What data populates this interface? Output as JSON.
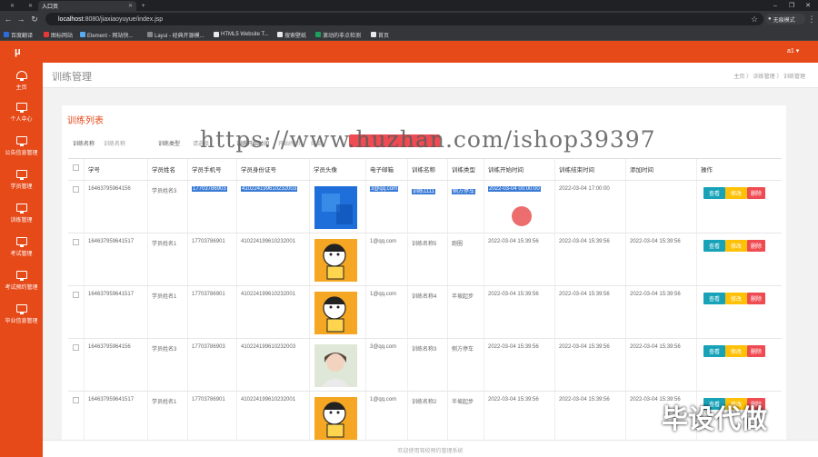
{
  "browser": {
    "tabs": [
      {
        "label": ""
      },
      {
        "label": ""
      },
      {
        "label": "入口页"
      }
    ],
    "url_host": "localhost",
    "url_rest": ":8080/jiaxiaoyuyue/index.jsp",
    "profile": "无痕模式",
    "bookmarks": [
      "百度翻译",
      "图标网站",
      "Element - 网站快...",
      "Layui - 经典开源模...",
      "HTML5 Website T...",
      "搜索壁纸",
      "滚动的非点检测",
      "首页"
    ]
  },
  "app": {
    "logo": "μ",
    "user": "a1 ▾",
    "sidebar": [
      {
        "label": "主页"
      },
      {
        "label": "个人中心"
      },
      {
        "label": "公告信息管理"
      },
      {
        "label": "学员管理"
      },
      {
        "label": "训练管理"
      },
      {
        "label": "考试管理"
      },
      {
        "label": "考试预约管理"
      },
      {
        "label": "毕业信息管理"
      }
    ],
    "page_title": "训练管理",
    "breadcrumb": "主页 〉 训练管理 〉 训练管理",
    "card_title": "训练列表",
    "filters": [
      "训练名称",
      "训练名称",
      "训练类型",
      "请选择",
      "训练开始时间",
      "开始时间",
      "结束"
    ],
    "footer": "欢迎使用驾校预约管理系统"
  },
  "table": {
    "headers": [
      "学号",
      "学员姓名",
      "学员手机号",
      "学员身份证号",
      "学员头像",
      "电子邮箱",
      "训练名称",
      "训练类型",
      "训练开始时间",
      "训练结束时间",
      "添加时间",
      "操作"
    ],
    "rows": [
      {
        "id": "1646379596415​6",
        "name": "学员姓名3",
        "phone": "17703786903",
        "idcard": "410224199610232003",
        "email": "3@qq.com",
        "train": "训练1111",
        "type": "侧方停车",
        "start": "2022-03-04 00:00:00",
        "end": "2022-03-04 17:00:00",
        "added": "",
        "avatar": "blue"
      },
      {
        "id": "16463795964151​7",
        "name": "学员姓名1",
        "phone": "17703786901",
        "idcard": "410224199610232001",
        "email": "1@qq.com",
        "train": "训练名称5",
        "type": "跑圈",
        "start": "2022-03-04 15:39:56",
        "end": "2022-03-04 15:39:56",
        "added": "2022-03-04 15:39:56",
        "avatar": "cartoon"
      },
      {
        "id": "16463795964151​7",
        "name": "学员姓名1",
        "phone": "17703786901",
        "idcard": "410224199610232001",
        "email": "1@qq.com",
        "train": "训练名称4",
        "type": "半坡起步",
        "start": "2022-03-04 15:39:56",
        "end": "2022-03-04 15:39:56",
        "added": "2022-03-04 15:39:56",
        "avatar": "cartoon"
      },
      {
        "id": "1646379596415​6",
        "name": "学员姓名3",
        "phone": "17703786903",
        "idcard": "410224199610232003",
        "email": "3@qq.com",
        "train": "训练名称3",
        "type": "侧方停车",
        "start": "2022-03-04 15:39:56",
        "end": "2022-03-04 15:39:56",
        "added": "2022-03-04 15:39:56",
        "avatar": "photo"
      },
      {
        "id": "16463795964151​7",
        "name": "学员姓名1",
        "phone": "17703786901",
        "idcard": "410224199610232001",
        "email": "1@qq.com",
        "train": "训练名称2",
        "type": "半坡起步",
        "start": "2022-03-04 15:39:56",
        "end": "2022-03-04 15:39:56",
        "added": "2022-03-04 15:39:56",
        "avatar": "cartoon"
      }
    ],
    "actions": {
      "view": "查看",
      "edit": "修改",
      "del": "删除"
    }
  },
  "overlay": {
    "watermark": "https://www.huzhan.com/ishop39397",
    "stamp": "毕设代做"
  }
}
